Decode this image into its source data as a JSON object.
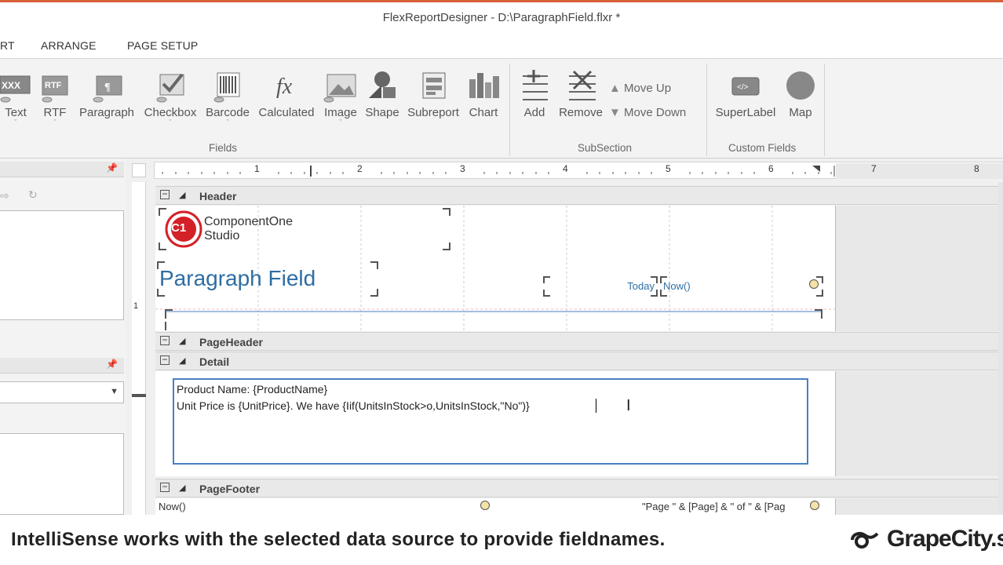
{
  "window": {
    "title": "FlexReportDesigner - D:\\ParagraphField.flxr *"
  },
  "ribbon": {
    "tabs": [
      {
        "label": "RT"
      },
      {
        "label": "ARRANGE"
      },
      {
        "label": "PAGE SETUP"
      }
    ],
    "fields_group": {
      "name": "Fields",
      "buttons": [
        {
          "label": "Text",
          "icon": "text-field-icon"
        },
        {
          "label": "RTF",
          "icon": "rtf-field-icon"
        },
        {
          "label": "Paragraph",
          "icon": "paragraph-field-icon"
        },
        {
          "label": "Checkbox",
          "icon": "checkbox-field-icon"
        },
        {
          "label": "Barcode",
          "icon": "barcode-field-icon"
        },
        {
          "label": "Calculated",
          "icon": "calculated-field-icon"
        },
        {
          "label": "Image",
          "icon": "image-field-icon"
        },
        {
          "label": "Shape",
          "icon": "shape-field-icon"
        },
        {
          "label": "Subreport",
          "icon": "subreport-icon"
        },
        {
          "label": "Chart",
          "icon": "chart-icon"
        }
      ]
    },
    "subsection_group": {
      "name": "SubSection",
      "add": "Add",
      "remove": "Remove",
      "move_up": "Move Up",
      "move_down": "Move Down"
    },
    "custom_group": {
      "name": "Custom Fields",
      "superlabel": "SuperLabel",
      "map": "Map"
    }
  },
  "ruler": {
    "marks": [
      "1",
      "2",
      "3",
      "4",
      "5",
      "6",
      "7",
      "8"
    ]
  },
  "vruler": {
    "mark": "1"
  },
  "design": {
    "header": {
      "name": "Header",
      "logo_line1": "ComponentOne",
      "logo_line2": "Studio",
      "logo_mark": "C1",
      "title_field": "Paragraph Field",
      "today_label": "Today",
      "now_expr": "Now()"
    },
    "page_header": {
      "name": "PageHeader"
    },
    "detail": {
      "name": "Detail",
      "line1": "Product Name: {ProductName}",
      "line2": "Unit Price is {UnitPrice}. We have {Iif(UnitsInStock>o,UnitsInStock,\"No\")}"
    },
    "page_footer": {
      "name": "PageFooter",
      "now_expr": "Now()",
      "page_expr": "\"Page \" & [Page] & \" of \" & [Pag"
    }
  },
  "caption": {
    "text": "IntelliSense works with the selected data source to provide fieldnames.",
    "brand": "GrapeCity.s"
  },
  "colors": {
    "accent": "#d7613a",
    "selection": "#4a7fc1",
    "title_text": "#2e6da4",
    "brand_red": "#d42027"
  }
}
